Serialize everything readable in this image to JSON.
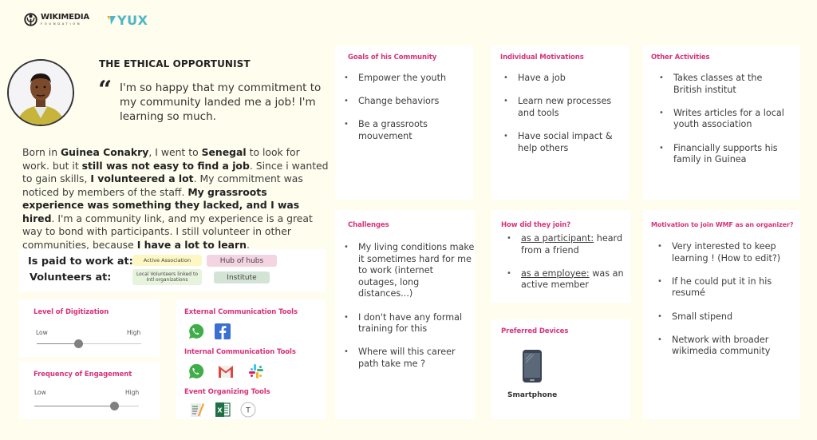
{
  "header": {
    "wikimedia_logo": {
      "name": "WIKIMEDIA",
      "sub": "FOUNDATION",
      "tm": "™"
    },
    "yux_logo": {
      "name": "YUX"
    }
  },
  "persona": {
    "avatar_icon": "person-avatar-illustration",
    "name": "THE ETHICAL OPPORTUNIST",
    "quote_mark": "“",
    "quote": "I'm so happy that my commitment to my community landed me a job! I'm learning so much.",
    "bio": [
      {
        "text": "Born in ",
        "bold": false
      },
      {
        "text": "Guinea Conakry",
        "bold": true
      },
      {
        "text": ", I went to ",
        "bold": false
      },
      {
        "text": "Senegal",
        "bold": true
      },
      {
        "text": " to look for work. but it ",
        "bold": false
      },
      {
        "text": "still was not easy to find a job",
        "bold": true
      },
      {
        "text": ". Since i wanted to gain skills, ",
        "bold": false
      },
      {
        "text": "I volunteered a lot",
        "bold": true
      },
      {
        "text": ". My commitment was noticed by members of the staff. ",
        "bold": false
      },
      {
        "text": "My grassroots experience was something they lacked, and I was hired",
        "bold": true
      },
      {
        "text": ". I'm a community link, and my experience is a great way to bond with participants. I still volunteer in other communities, because ",
        "bold": false
      },
      {
        "text": "I have a lot to learn",
        "bold": true
      },
      {
        "text": ".",
        "bold": false
      }
    ]
  },
  "work": {
    "paid_label": "Is paid to work at:",
    "volunteer_label": "Volunteers at:",
    "paid_tags": [
      {
        "label": "Active Association",
        "color": "#fcf7c3"
      },
      {
        "label": "Hub of hubs",
        "color": "#f4d4e0"
      }
    ],
    "volunteer_tags": [
      {
        "label": "Local Volunteers linked to Intl organizations",
        "color": "#e8f3de"
      },
      {
        "label": "Institute",
        "color": "#d3e4d6"
      }
    ]
  },
  "sliders": [
    {
      "title": "Level of Digitization",
      "low": "Low",
      "high": "High",
      "value": 0.4
    },
    {
      "title": "Frequency of Engagement",
      "low": "Low",
      "high": "High",
      "value": 0.77
    }
  ],
  "tools": {
    "external": {
      "title": "External Communication Tools",
      "icons": [
        "whatsapp-icon",
        "facebook-icon"
      ]
    },
    "internal": {
      "title": "Internal Communication Tools",
      "icons": [
        "whatsapp-icon",
        "gmail-icon",
        "slack-icon"
      ]
    },
    "event": {
      "title": "Event Organizing Tools",
      "icons": [
        "notes-icon",
        "excel-icon",
        "typeform-icon"
      ]
    }
  },
  "cards": {
    "goals": {
      "title": "Goals of his Community",
      "items": [
        "Empower the youth",
        "Change behaviors",
        "Be a grassroots mouvement"
      ]
    },
    "motivations": {
      "title": "Individual Motivations",
      "items": [
        "Have a job",
        "Learn new processes and tools",
        "Have social impact & help others"
      ]
    },
    "other": {
      "title": "Other Activities",
      "items": [
        "Takes classes at the British institut",
        "Writes articles for a local youth association",
        "Financially supports his family in Guinea"
      ]
    },
    "challenges": {
      "title": "Challenges",
      "items": [
        "My living conditions make it sometimes hard for me to work (internet outages, long distances...)",
        "I don't have any formal training for this",
        "Where will this career path take me ?"
      ]
    },
    "join": {
      "title": "How did they join?",
      "items": [
        {
          "label": "as a participant:",
          "text": " heard from a friend"
        },
        {
          "label": "as a employee:",
          "text": " was an active member"
        }
      ]
    },
    "devices": {
      "title": "Preferred Devices",
      "device_icon": "smartphone-icon",
      "device_label": "Smartphone"
    },
    "wmf": {
      "title": "Motivation to join WMF as an organizer?",
      "items": [
        "Very interested to keep learning ! (How to edit?)",
        "If he could put it in his resumé",
        "Small stipend",
        "Network with broader wikimedia community"
      ]
    }
  },
  "colors": {
    "background": "#fefdee",
    "accent": "#d6337a",
    "card": "#ffffff"
  }
}
